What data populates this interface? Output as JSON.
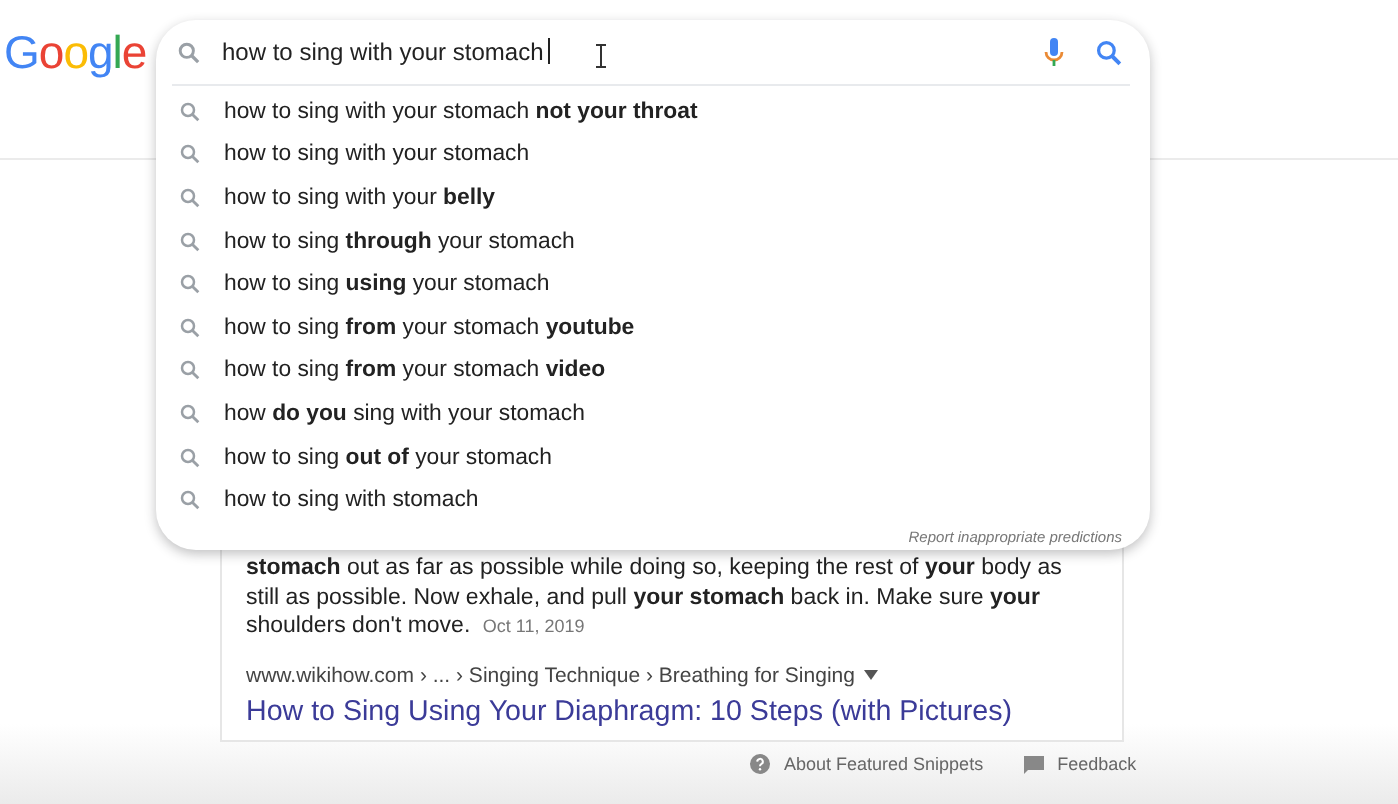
{
  "logo": "Google",
  "search": {
    "value": "how to sing with your stomach"
  },
  "suggestions": [
    {
      "text": "how to sing with your stomach **not your throat**"
    },
    {
      "text": "how to sing with your stomach"
    },
    {
      "text": "how to sing with your **belly**"
    },
    {
      "text": "how to sing **through** your stomach"
    },
    {
      "text": "how to sing **using** your stomach"
    },
    {
      "text": "how to sing **from** your stomach **youtube**"
    },
    {
      "text": "how to sing **from** your stomach **video**"
    },
    {
      "text": "how **do you** sing with your stomach"
    },
    {
      "text": "how to sing **out of** your stomach"
    },
    {
      "text": "how to sing with stomach"
    }
  ],
  "report_link": "Report inappropriate predictions",
  "snippet": {
    "text": "**stomach** out as far as possible while doing so, keeping the rest of **your** body as still as possible. Now exhale, and pull **your stomach** back in. Make sure **your** shoulders don't move.",
    "date": "Oct 11, 2019",
    "breadcrumb": "www.wikihow.com › ... › Singing Technique › Breathing for Singing",
    "title": "How to Sing Using Your Diaphragm: 10 Steps (with Pictures)"
  },
  "footer": [
    {
      "kind": "help",
      "label": "About Featured Snippets"
    },
    {
      "kind": "feedback",
      "label": "Feedback"
    }
  ]
}
